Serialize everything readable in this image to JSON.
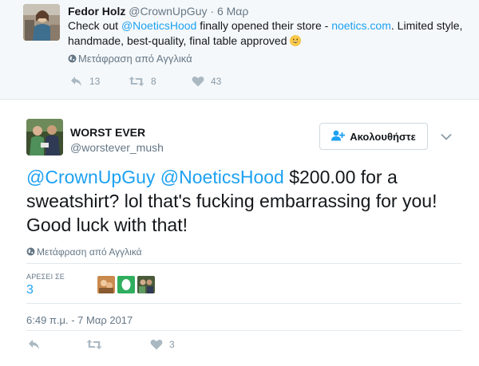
{
  "parent_tweet": {
    "name": "Fedor Holz",
    "handle": "@CrownUpGuy",
    "dot": "·",
    "time": "6 Μαρ",
    "text_before": "Check out ",
    "mention": "@NoeticsHood",
    "text_middle": " finally opened their store - ",
    "link": "noetics.com",
    "text_after": ". Limited style, handmade, best-quality, final table approved ",
    "emoji_icon": "grinning-face-emoji",
    "translate_label": "Μετάφραση από Αγγλικά",
    "reply_count": "13",
    "retweet_count": "8",
    "like_count": "43"
  },
  "main_tweet": {
    "name": "WORST EVER",
    "handle": "@worstever_mush",
    "follow_label": "Ακολουθήστε",
    "mention_1": "@CrownUpGuy",
    "space": " ",
    "mention_2": "@NoeticsHood",
    "text": " $200.00 for a sweatshirt? lol that's fucking embarrassing for you! Good luck with that!",
    "translate_label": "Μετάφραση από Αγγλικά",
    "likes_label": "ΑΡΕΣΕΙ ΣΕ",
    "likes_count": "3",
    "timestamp": "6:49 π.μ. - 7 Μαρ 2017",
    "like_count": "3"
  },
  "colors": {
    "accent": "#1da1f2",
    "muted": "#657786",
    "action_icon": "#aab8c2",
    "parent_bg": "#f5f8fa",
    "border": "#e1e8ed"
  }
}
